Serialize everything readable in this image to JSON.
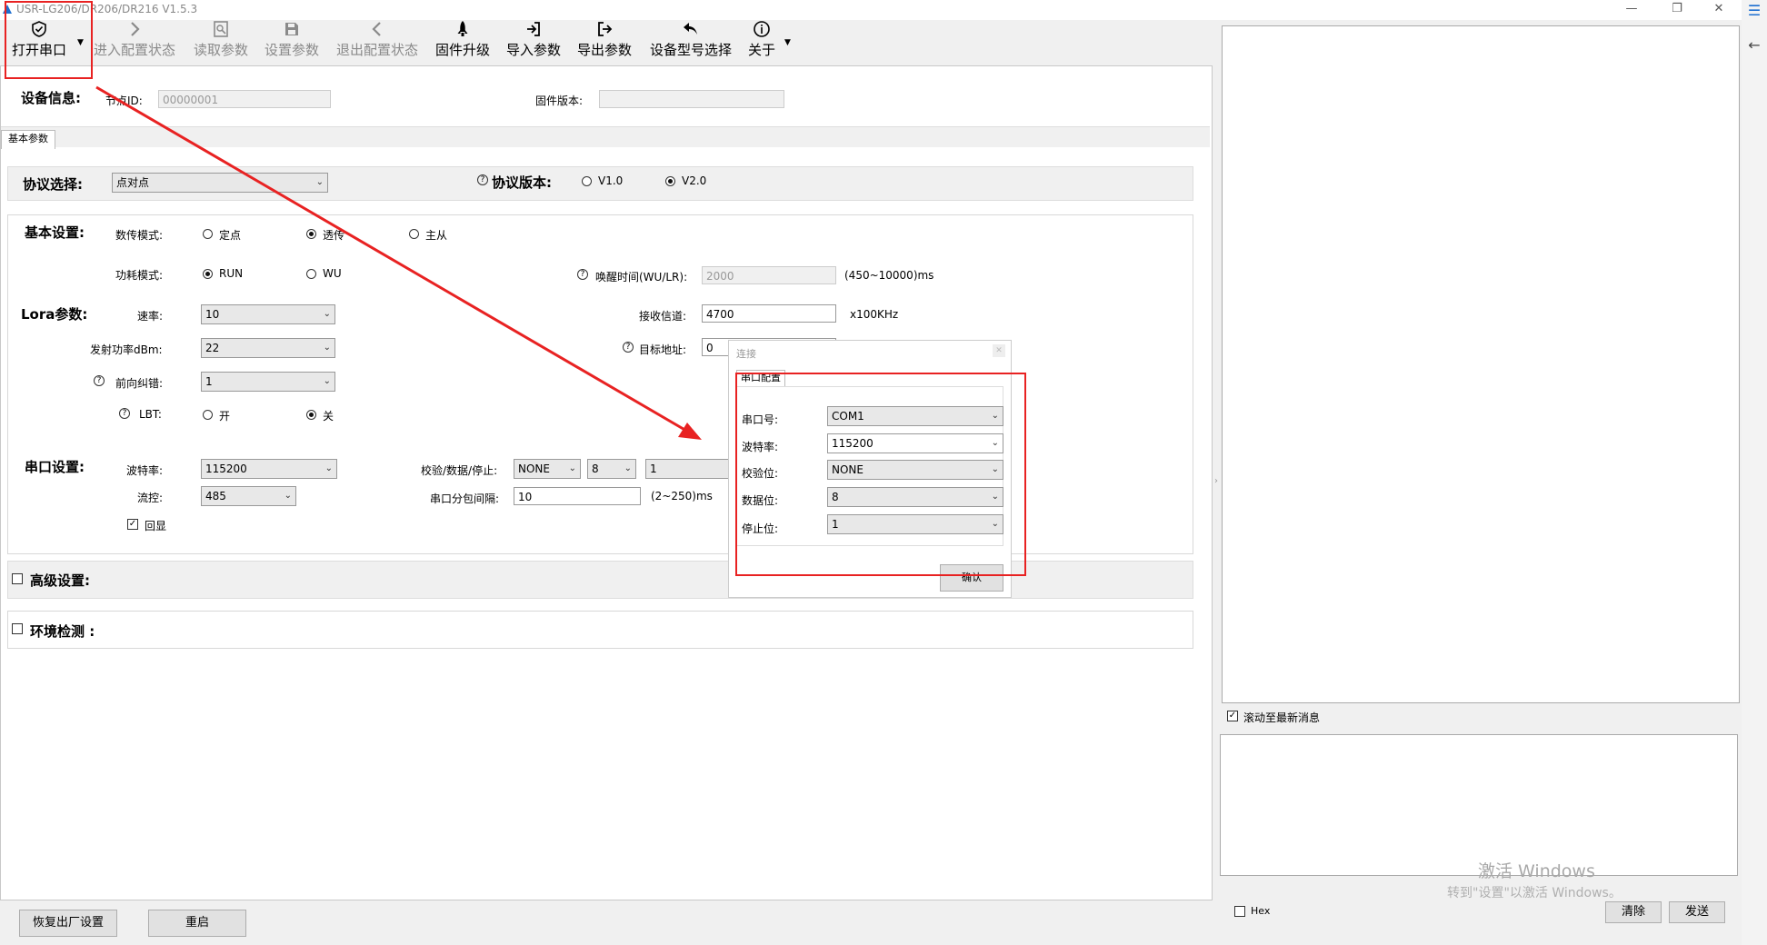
{
  "window": {
    "title": "USR-LG206/DR206/DR216 V1.5.3",
    "minimize_glyph": "—",
    "restore_glyph": "❐",
    "close_glyph": "✕"
  },
  "toolbar": {
    "open_port": "打开串口",
    "enter_config": "进入配置状态",
    "read_params": "读取参数",
    "set_params": "设置参数",
    "exit_config": "退出配置状态",
    "firmware_upgrade": "固件升级",
    "import_params": "导入参数",
    "export_params": "导出参数",
    "device_model": "设备型号选择",
    "about": "关于"
  },
  "device_info": {
    "title": "设备信息:",
    "node_id_label": "节点ID:",
    "node_id_value": "00000001",
    "firmware_label": "固件版本:",
    "firmware_value": ""
  },
  "tabs": {
    "basic": "基本参数"
  },
  "protocol": {
    "title": "协议选择:",
    "selected": "点对点",
    "version_label": "协议版本:",
    "v1": "V1.0",
    "v2": "V2.0",
    "selected_version": "V2.0"
  },
  "basic": {
    "title": "基本设置:",
    "data_mode_label": "数传模式:",
    "mode_fixed": "定点",
    "mode_transparent": "透传",
    "mode_master_slave": "主从",
    "power_mode_label": "功耗模式:",
    "power_run": "RUN",
    "power_wu": "WU",
    "wakeup_label": "唤醒时间(WU/LR):",
    "wakeup_value": "2000",
    "wakeup_range": "(450~10000)ms"
  },
  "lora": {
    "title": "Lora参数:",
    "rate_label": "速率:",
    "rate_value": "10",
    "tx_power_label": "发射功率dBm:",
    "tx_power_value": "22",
    "fec_label": "前向纠错:",
    "fec_value": "1",
    "lbt_label": "LBT:",
    "lbt_on": "开",
    "lbt_off": "关",
    "channel_label": "接收信道:",
    "channel_value": "4700",
    "channel_unit": "x100KHz",
    "target_label": "目标地址:",
    "target_value": "0"
  },
  "serial": {
    "title": "串口设置:",
    "baud_label": "波特率:",
    "baud_value": "115200",
    "flow_label": "流控:",
    "flow_value": "485",
    "echo_label": "回显",
    "parity_label": "校验/数据/停止:",
    "parity_value": "NONE",
    "data_value": "8",
    "stop_value": "1",
    "interval_label": "串口分包间隔:",
    "interval_value": "10",
    "interval_range": "(2~250)ms"
  },
  "advanced": {
    "title": "高级设置:"
  },
  "env": {
    "title": "环境检测 :"
  },
  "bottom": {
    "factory_reset": "恢复出厂设置",
    "restart": "重启"
  },
  "dialog": {
    "title": "连接",
    "tab": "串口配置",
    "port_label": "串口号:",
    "port_value": "COM1",
    "baud_label": "波特率:",
    "baud_value": "115200",
    "parity_label": "校验位:",
    "parity_value": "NONE",
    "data_label": "数据位:",
    "data_value": "8",
    "stop_label": "停止位:",
    "stop_value": "1",
    "confirm": "确认"
  },
  "right": {
    "scroll_latest": "滚动至最新消息",
    "hex_label": "Hex",
    "clear": "清除",
    "send": "发送"
  },
  "watermark": {
    "line1": "激活 Windows",
    "line2": "转到\"设置\"以激活 Windows。"
  },
  "colors": {
    "annotation_red": "#e82222"
  }
}
